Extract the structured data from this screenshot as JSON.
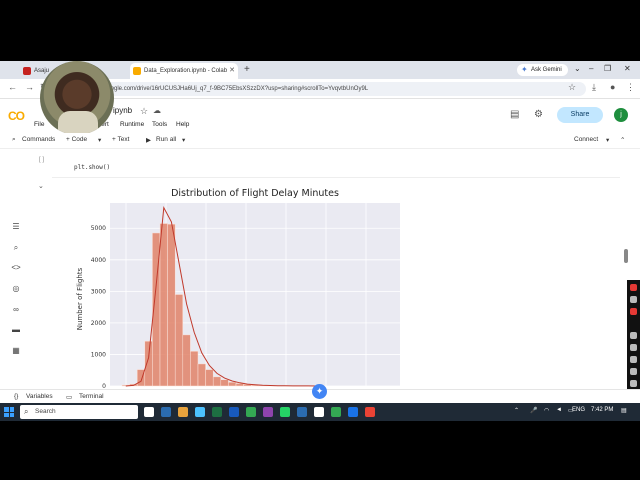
{
  "browser": {
    "tabs": [
      {
        "label": "Asaju",
        "favicon_color": "#c5221f"
      },
      {
        "label": "Data_Exploration.ipynb - Colab",
        "favicon_color": "#f9ab00"
      }
    ],
    "new_tab": "+",
    "gemini_label": "Ask Gemini",
    "window_controls": [
      "⌄",
      "–",
      "❐",
      "✕"
    ],
    "url": "ca.google.com/drive/16rUCUSJHa6Uj_q7_f-9BC75EbsXSzzDX?usp=sharing#scrollTo=YvqvtbUnOy9L"
  },
  "colab": {
    "logo": "CO",
    "notebook_name": "ipynb",
    "menus": [
      "File",
      "sert",
      "Runtime",
      "Tools",
      "Help"
    ],
    "share_label": "Share",
    "avatar_letter": "j",
    "toolbar": {
      "commands": "Commands",
      "code": "+ Code",
      "text": "+ Text",
      "run_all": "Run all",
      "connect": "Connect"
    },
    "cell_bracket": "[ ]",
    "code_line": "plt.show()",
    "bottom": {
      "variables": "Variables",
      "terminal": "Terminal"
    }
  },
  "chart_data": {
    "type": "bar",
    "title": "Distribution of Flight Delay Minutes",
    "ylabel": "Number of Flights",
    "xlabel": "",
    "ylim": [
      0,
      5800
    ],
    "yticks": [
      0,
      1000,
      2000,
      3000,
      4000,
      5000
    ],
    "bar_color": "#e08268",
    "kde_color": "#c0392b",
    "values": [
      30,
      60,
      520,
      1420,
      4850,
      5150,
      5130,
      2900,
      1620,
      1100,
      700,
      520,
      290,
      200,
      120,
      80,
      50,
      30,
      20,
      10,
      8,
      5,
      4,
      3,
      2,
      2
    ],
    "kde": [
      0,
      20,
      150,
      900,
      3200,
      5650,
      5200,
      3900,
      2600,
      1700,
      1050,
      650,
      400,
      250,
      160,
      100,
      60,
      40,
      25,
      15,
      10,
      6,
      4,
      3,
      2,
      1
    ],
    "grid": true
  },
  "taskbar": {
    "search_label": "Search",
    "lang": "ENG",
    "time": "7:42 PM",
    "app_colors": [
      "#ffffff",
      "#2b6cb0",
      "#e8a33d",
      "#4cc2ff",
      "#1d6f42",
      "#185abd",
      "#34a853",
      "#8e44ad",
      "#25d366",
      "#2b6cb0",
      "#ffffff",
      "#34a853",
      "#1a73e8",
      "#ea4335"
    ]
  }
}
